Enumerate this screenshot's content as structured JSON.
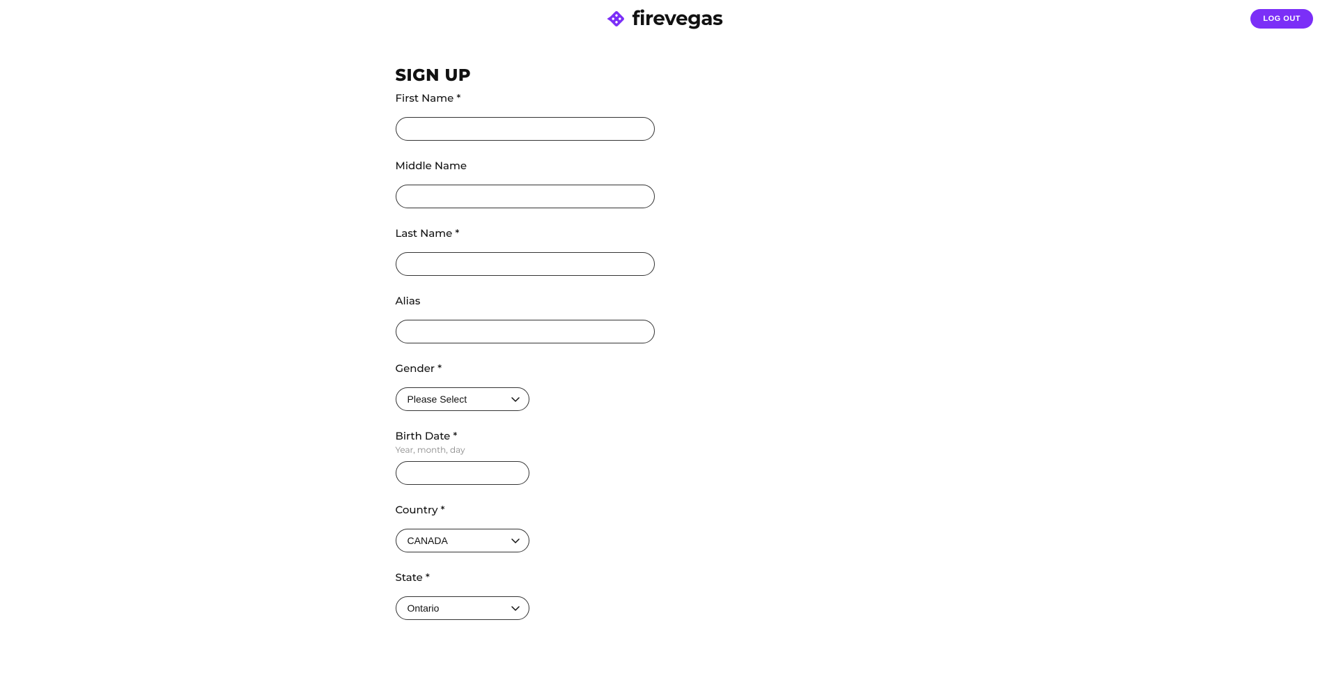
{
  "header": {
    "brand_name": "firevegas",
    "logout_label": "LOG OUT"
  },
  "page": {
    "title": "SIGN UP"
  },
  "form": {
    "first_name": {
      "label": "First Name *",
      "value": ""
    },
    "middle_name": {
      "label": "Middle Name",
      "value": ""
    },
    "last_name": {
      "label": "Last Name *",
      "value": ""
    },
    "alias": {
      "label": "Alias",
      "value": ""
    },
    "gender": {
      "label": "Gender *",
      "selected": "Please Select"
    },
    "birth_date": {
      "label": "Birth Date *",
      "help": "Year, month, day",
      "value": ""
    },
    "country": {
      "label": "Country *",
      "selected": "CANADA"
    },
    "state": {
      "label": "State *",
      "selected": "Ontario"
    }
  },
  "colors": {
    "accent": "#7b2ff7"
  }
}
